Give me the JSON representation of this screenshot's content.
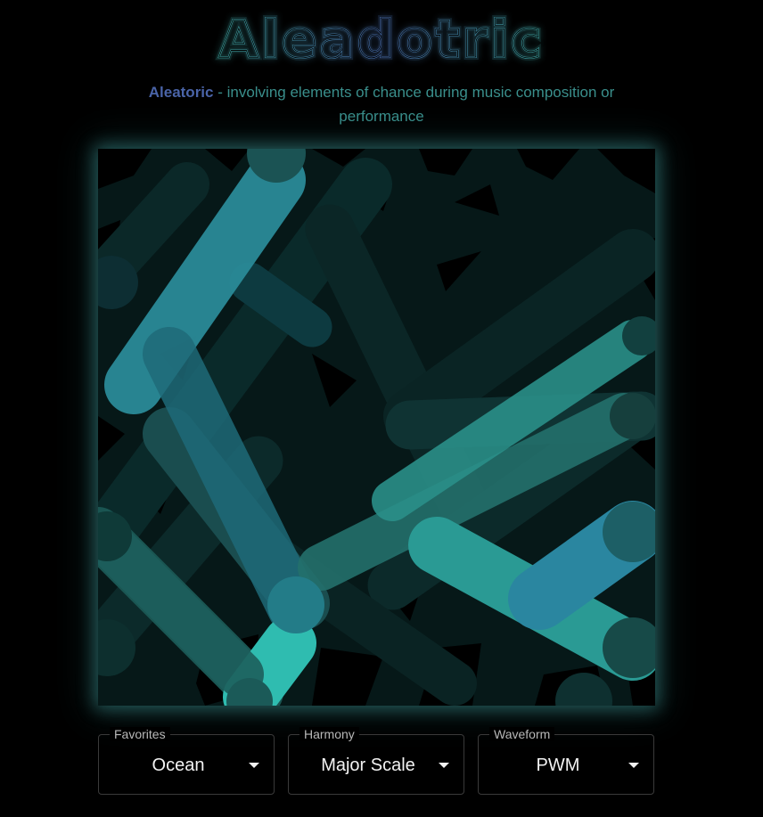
{
  "app": {
    "title": "Aleadotric"
  },
  "subtitle": {
    "term": "Aleatoric",
    "definition": " - involving elements of chance during music composition or performance"
  },
  "controls": {
    "favorites": {
      "label": "Favorites",
      "value": "Ocean"
    },
    "harmony": {
      "label": "Harmony",
      "value": "Major Scale"
    },
    "waveform": {
      "label": "Waveform",
      "value": "PWM"
    }
  },
  "colors": {
    "background": "#000000",
    "canvas_background": "#061818",
    "title_stroke": "#3e9c9a",
    "term_color": "#4a64a8",
    "subtitle_color": "#3a8f8c",
    "accent_teal": "#2fb8a8",
    "accent_blue": "#2a8ea0"
  },
  "icons": {
    "dropdown": "triangle-down"
  }
}
